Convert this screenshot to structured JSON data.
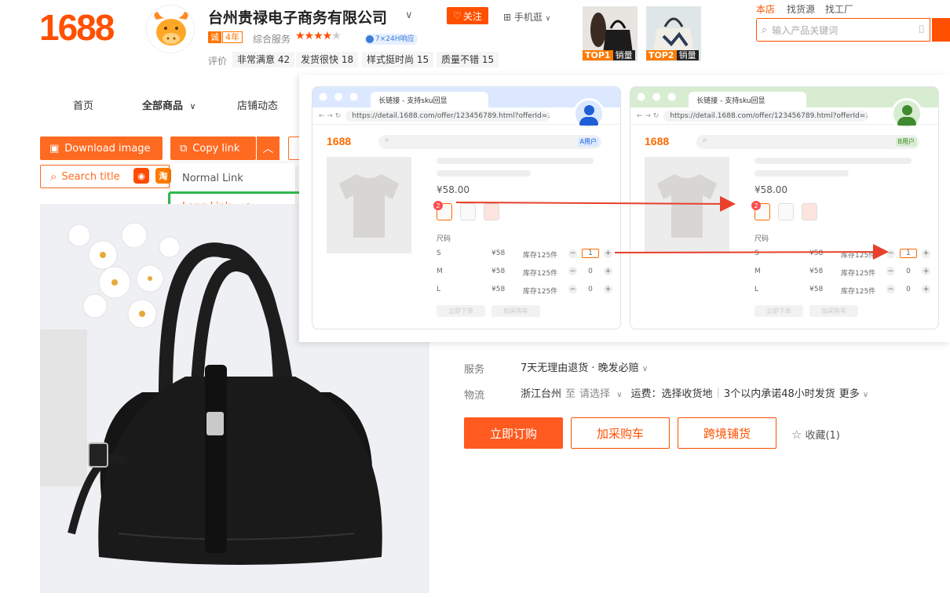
{
  "header": {
    "logo": "1688",
    "shop_name": "台州贵禄电子商务有限公司",
    "follow_label": "关注",
    "mobile_label": "手机逛",
    "cheng_badge": "诚",
    "years_badge": "4年",
    "service_label": "综合服务",
    "rating_stars": 4,
    "response_label": "7×24H响应",
    "evaluation_label": "评价",
    "evaluations": [
      {
        "label": "非常满意 42"
      },
      {
        "label": "发货很快 18"
      },
      {
        "label": "样式挺时尚 15"
      },
      {
        "label": "质量不错 15"
      }
    ],
    "top_products": [
      {
        "rank": "TOP1",
        "tag": "销量"
      },
      {
        "rank": "TOP2",
        "tag": "销量"
      }
    ],
    "links": [
      "本店",
      "找货源",
      "找工厂"
    ],
    "search_placeholder": "输入产品关键词"
  },
  "nav": {
    "items": [
      "首页",
      "全部商品",
      "店铺动态"
    ]
  },
  "toolbar": {
    "download_label": "Download image",
    "copy_link_label": "Copy link",
    "search_title_label": "Search title",
    "icon_taobao": "淘"
  },
  "copy_menu": {
    "options": [
      "Normal Link",
      "Long Link"
    ],
    "selected": "Long Link"
  },
  "overlay": {
    "browsers": [
      {
        "tab_title": "长链接 - 支持sku回显",
        "url": "https://detail.1688.com/offer/123456789.html?offerId=12345...",
        "logo": "1688",
        "user_tag": "A用户",
        "price": "¥58.00",
        "badge_count": "2",
        "size_label": "尺码",
        "rows": [
          {
            "size": "S",
            "price": "¥58",
            "stock": "库存125件",
            "qty": "1"
          },
          {
            "size": "M",
            "price": "¥58",
            "stock": "库存125件",
            "qty": "0"
          },
          {
            "size": "L",
            "price": "¥58",
            "stock": "库存125件",
            "qty": "0"
          }
        ],
        "buy_btn": "立即下单",
        "cart_btn": "加采购车"
      },
      {
        "tab_title": "长链接 - 支持sku回显",
        "url": "https://detail.1688.com/offer/123456789.html?offerId=12345...",
        "logo": "1688",
        "user_tag": "B用户",
        "price": "¥58.00",
        "badge_count": "2",
        "size_label": "尺码",
        "rows": [
          {
            "size": "S",
            "price": "¥58",
            "stock": "库存125件",
            "qty": "1"
          },
          {
            "size": "M",
            "price": "¥58",
            "stock": "库存125件",
            "qty": "0"
          },
          {
            "size": "L",
            "price": "¥58",
            "stock": "库存125件",
            "qty": "0"
          }
        ],
        "buy_btn": "立即下单",
        "cart_btn": "加采购车"
      }
    ]
  },
  "details": {
    "service_label": "服务",
    "service_text": "7天无理由退货 · 晚发必赔",
    "logistics_label": "物流",
    "origin": "浙江台州",
    "to_label": "至",
    "destination": "请选择",
    "shipping": "运费：选择收货地",
    "promise": "3个以内承诺48小时发货",
    "more": "更多"
  },
  "actions": {
    "buy": "立即订购",
    "cart": "加采购车",
    "cross_border": "跨境铺货",
    "favorite": "收藏(1)"
  },
  "colors": {
    "brand": "#ff5000",
    "highlight_green": "#2fb850",
    "browser_a": "#dbe8ff",
    "browser_b": "#d8ecd2"
  }
}
